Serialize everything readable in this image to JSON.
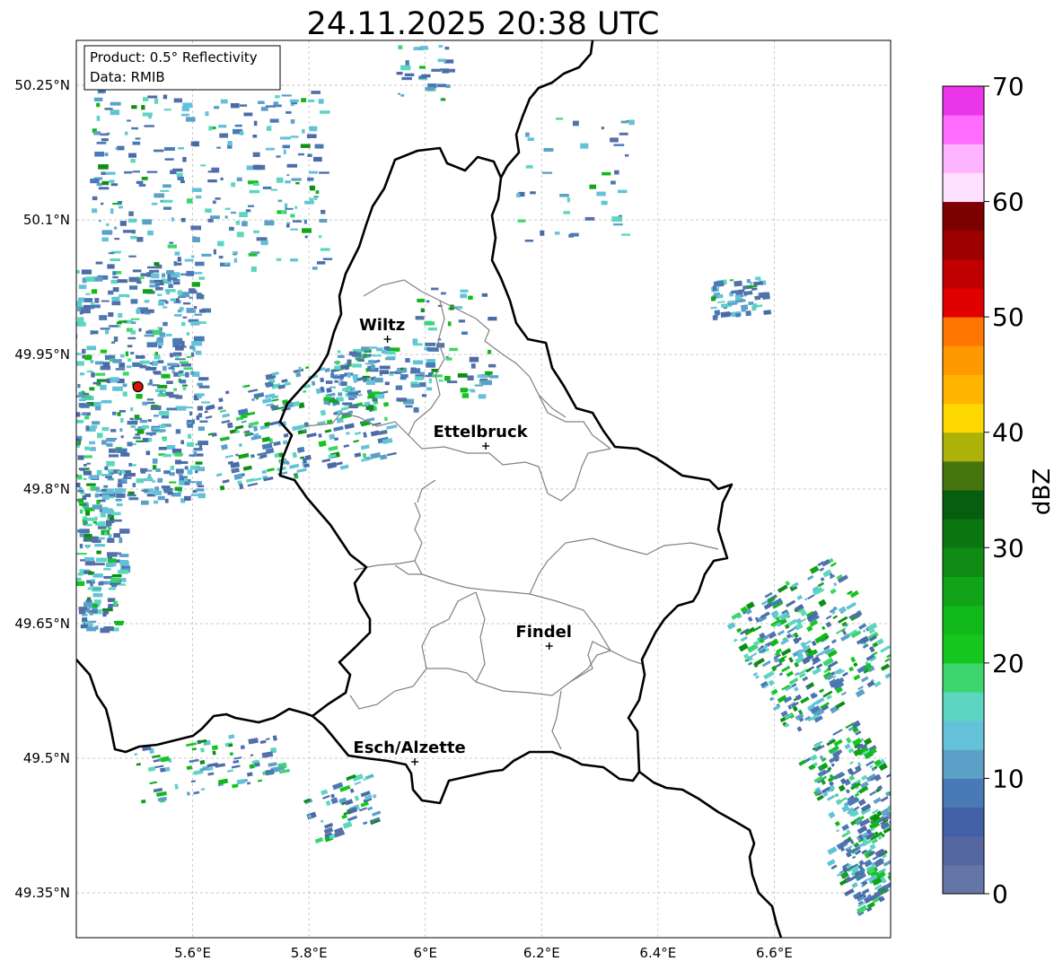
{
  "title": "24.11.2025 20:38 UTC",
  "info_box": {
    "product": "Product: 0.5° Reflectivity",
    "data": "Data: RMIB"
  },
  "map": {
    "lon_range": [
      5.4,
      6.8
    ],
    "lat_range": [
      49.3,
      50.3
    ],
    "lon_ticks": [
      {
        "value": 5.6,
        "label": "5.6°E"
      },
      {
        "value": 5.8,
        "label": "5.8°E"
      },
      {
        "value": 6.0,
        "label": "6°E"
      },
      {
        "value": 6.2,
        "label": "6.2°E"
      },
      {
        "value": 6.4,
        "label": "6.4°E"
      },
      {
        "value": 6.6,
        "label": "6.6°E"
      }
    ],
    "lat_ticks": [
      {
        "value": 50.25,
        "label": "50.25°N"
      },
      {
        "value": 50.1,
        "label": "50.1°N"
      },
      {
        "value": 49.95,
        "label": "49.95°N"
      },
      {
        "value": 49.8,
        "label": "49.8°N"
      },
      {
        "value": 49.65,
        "label": "49.65°N"
      },
      {
        "value": 49.5,
        "label": "49.5°N"
      },
      {
        "value": 49.35,
        "label": "49.35°N"
      }
    ],
    "cities": [
      {
        "name": "Wiltz",
        "lon": 5.935,
        "lat": 49.967
      },
      {
        "name": "Ettelbruck",
        "lon": 6.104,
        "lat": 49.848
      },
      {
        "name": "Findel",
        "lon": 6.213,
        "lat": 49.625
      },
      {
        "name": "Esch/Alzette",
        "lon": 5.982,
        "lat": 49.496
      }
    ],
    "radar_site": {
      "lon": 5.506,
      "lat": 49.914,
      "color": "#dd1111"
    }
  },
  "colorbar": {
    "label": "dBZ",
    "min": 0,
    "max": 70,
    "tick_labels": [
      "0",
      "10",
      "20",
      "30",
      "40",
      "50",
      "60",
      "70"
    ],
    "colors": [
      "#6475a8",
      "#5467a1",
      "#4260a6",
      "#4a7ab5",
      "#5ca0c8",
      "#64c2d8",
      "#5cd6c0",
      "#3dd66e",
      "#14c61e",
      "#10b81a",
      "#12a418",
      "#0f8c14",
      "#0b7710",
      "#075e0e",
      "#45750f",
      "#acb208",
      "#ffd700",
      "#ffb400",
      "#ff9900",
      "#ff7700",
      "#e00000",
      "#c00000",
      "#9e0000",
      "#7c0000",
      "#ffe0ff",
      "#ffb4ff",
      "#ff6cff",
      "#ea35ea"
    ]
  }
}
